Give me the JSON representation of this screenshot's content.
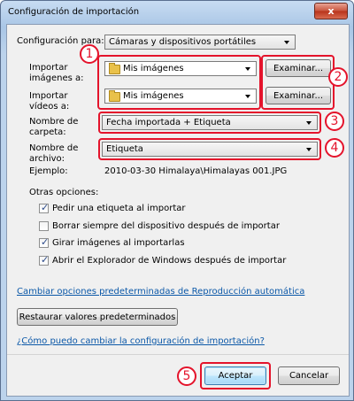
{
  "window": {
    "title": "Configuración de importación",
    "close_glyph": "x"
  },
  "config_for": {
    "label": "Configuración para:",
    "value": "Cámaras y dispositivos portátiles"
  },
  "import_images": {
    "label_line1": "Importar",
    "label_line2": "imágenes a:",
    "value": "Mis imágenes",
    "browse": "Examinar..."
  },
  "import_videos": {
    "label_line1": "Importar",
    "label_line2": "vídeos a:",
    "value": "Mis imágenes",
    "browse": "Examinar..."
  },
  "folder_name": {
    "label_line1": "Nombre de",
    "label_line2": "carpeta:",
    "value": "Fecha importada + Etiqueta"
  },
  "file_name": {
    "label_line1": "Nombre de",
    "label_line2": "archivo:",
    "value": "Etiqueta"
  },
  "example": {
    "label": "Ejemplo:",
    "value": "2010-03-30 Himalaya\\Himalayas 001.JPG"
  },
  "other_options": {
    "heading": "Otras opciones:",
    "items": [
      {
        "label": "Pedir una etiqueta al importar",
        "checked": true,
        "mark": "✓"
      },
      {
        "label": "Borrar siempre del dispositivo después de importar",
        "checked": false,
        "mark": ""
      },
      {
        "label": "Girar imágenes al importarlas",
        "checked": true,
        "mark": "✓"
      },
      {
        "label": "Abrir el Explorador de Windows después de importar",
        "checked": true,
        "mark": "✓"
      }
    ]
  },
  "links": {
    "autoplay": "Cambiar opciones predeterminadas de Reproducción automática",
    "help": "¿Cómo puedo cambiar la configuración de importación?"
  },
  "restore_button": "Restaurar valores predeterminados",
  "footer": {
    "accept": "Aceptar",
    "cancel": "Cancelar"
  },
  "callouts": [
    "1",
    "2",
    "3",
    "4",
    "5"
  ],
  "colors": {
    "callout_red": "#e4132b",
    "link_blue": "#0b58a8"
  }
}
